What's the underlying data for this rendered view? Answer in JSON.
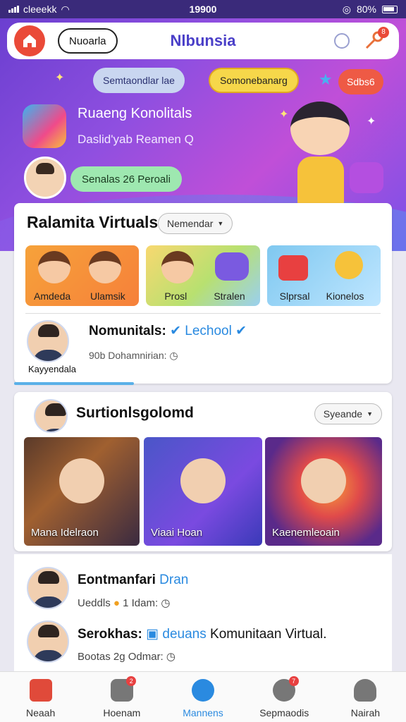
{
  "status_bar": {
    "carrier": "cleeekk",
    "time": "19900",
    "battery": "80%"
  },
  "header": {
    "button_label": "Nuoarla",
    "title": "Nlbunsia",
    "notification_badge": "8"
  },
  "hero": {
    "chips": [
      "Semtaondlar lae",
      "Somonebanarg",
      "Sdbs6"
    ],
    "title": "Ruaeng Konolitals",
    "subtitle": "Daslid'yab Reamen Q",
    "online_label": "Senalas 26 Peroali"
  },
  "community_card": {
    "title": "Ralamita Virtuals",
    "filter_label": "Nemendar",
    "tiles": [
      {
        "labels": [
          "Amdeda",
          "Ulamsik"
        ]
      },
      {
        "labels": [
          "Prosl",
          "Stralen"
        ]
      },
      {
        "labels": [
          "Slprsal",
          "Kionelos"
        ]
      }
    ],
    "user": {
      "name": "Nomunitals:",
      "tag": "Lechool",
      "handle": "Kayyendala",
      "meta": "90b Dohamnirian:"
    }
  },
  "media_card": {
    "title": "Surtionlsgolomd",
    "filter_label": "Syeande",
    "items": [
      "Mana Idelraon",
      "Viaai Hoan",
      "Kaenemleoain"
    ]
  },
  "feed": [
    {
      "title": "Eontmanfari",
      "highlight": "Dran",
      "meta": "Ueddls",
      "meta2": "1 Idam:"
    },
    {
      "title": "Serokhas:",
      "highlight": "deuans",
      "title_rest": "Komunitaan Virtual.",
      "meta": "Bootas 2g Odmar:"
    }
  ],
  "bottom_nav": [
    {
      "label": "Neaah",
      "icon": "home-icon",
      "badge": ""
    },
    {
      "label": "Hoenam",
      "icon": "camera-icon",
      "badge": "2"
    },
    {
      "label": "Mannens",
      "icon": "chat-icon",
      "badge": ""
    },
    {
      "label": "Sepmaodis",
      "icon": "group-icon",
      "badge": "7"
    },
    {
      "label": "Nairah",
      "icon": "profile-icon",
      "badge": ""
    }
  ],
  "colors": {
    "accent": "#2a8ae0",
    "brand_purple": "#6b3fd0",
    "home_red": "#ea4a38"
  }
}
